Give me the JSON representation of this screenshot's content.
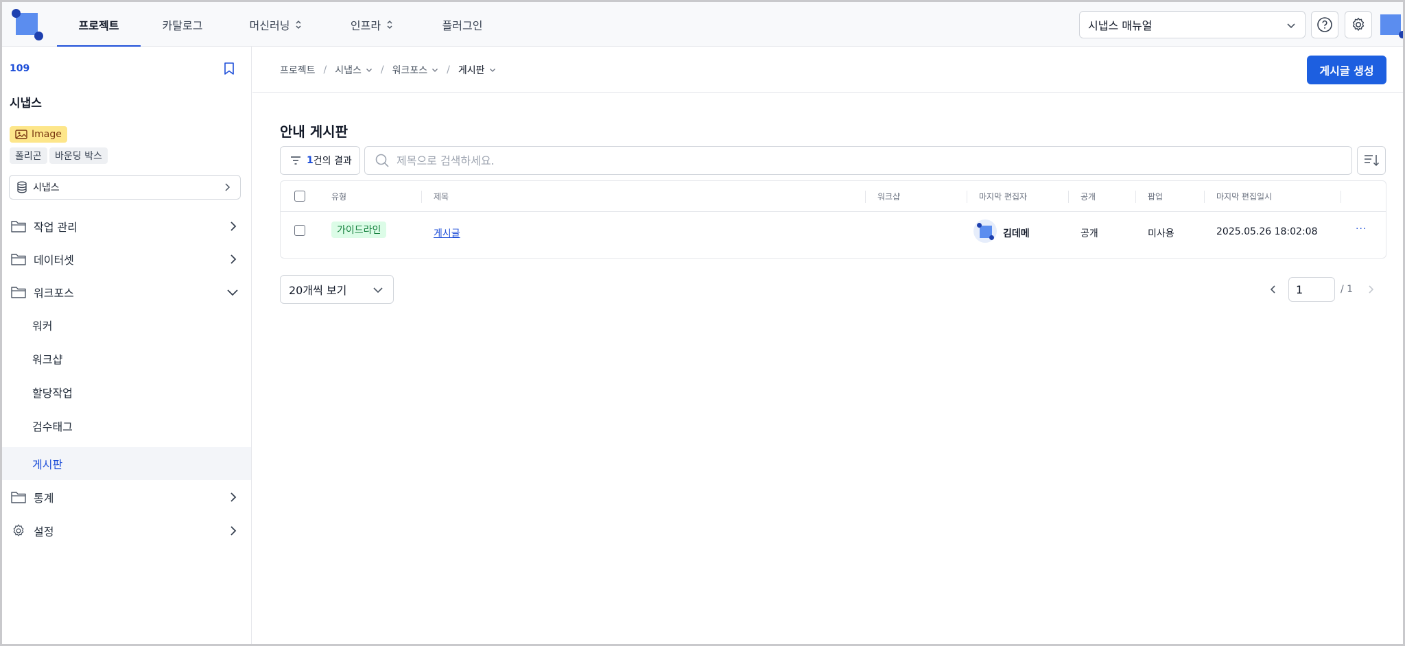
{
  "nav": {
    "items": [
      {
        "label": "프로젝트",
        "active": true,
        "has_updown": false
      },
      {
        "label": "카탈로그",
        "active": false,
        "has_updown": false
      },
      {
        "label": "머신러닝",
        "active": false,
        "has_updown": true
      },
      {
        "label": "인프라",
        "active": false,
        "has_updown": true
      },
      {
        "label": "플러그인",
        "active": false,
        "has_updown": false
      }
    ],
    "manual_select_value": "시냅스 매뉴얼"
  },
  "sidebar": {
    "project_id": "109",
    "project_name": "시냅스",
    "type_tag": "Image",
    "annotation_tags": [
      "폴리곤",
      "바운딩 박스"
    ],
    "dataset_label": "시냅스",
    "menu": {
      "task_management": "작업 관리",
      "dataset": "데이터셋",
      "workforce": "워크포스",
      "statistics": "통계",
      "settings": "설정"
    },
    "workforce_sub": [
      "워커",
      "워크샵",
      "할당작업",
      "검수태그",
      "게시판"
    ]
  },
  "main": {
    "breadcrumb": [
      "프로젝트",
      "시냅스",
      "워크포스",
      "게시판"
    ],
    "create_button": "게시글 생성",
    "board_title": "안내 게시판",
    "filter": {
      "count": "1",
      "suffix": "건의 결과"
    },
    "search_placeholder": "제목으로 검색하세요.",
    "table": {
      "headers": [
        "유형",
        "제목",
        "워크샵",
        "마지막 편집자",
        "공개",
        "팝업",
        "마지막 편집일시"
      ],
      "rows": [
        {
          "type": "가이드라인",
          "title": "게시글",
          "workshop": "",
          "editor": "김데메",
          "visibility": "공개",
          "popup": "미사용",
          "edited_at": "2025.05.26 18:02:08",
          "more": "···"
        }
      ]
    },
    "page_size": "20개씩 보기",
    "pagination": {
      "current": "1",
      "total": "/ 1"
    }
  },
  "colors": {
    "primary": "#1d5fe0",
    "link": "#1d4ed8",
    "image_tag_bg": "#fde68a",
    "guide_badge_bg": "#dcfce7",
    "guide_badge_text": "#15803d"
  }
}
